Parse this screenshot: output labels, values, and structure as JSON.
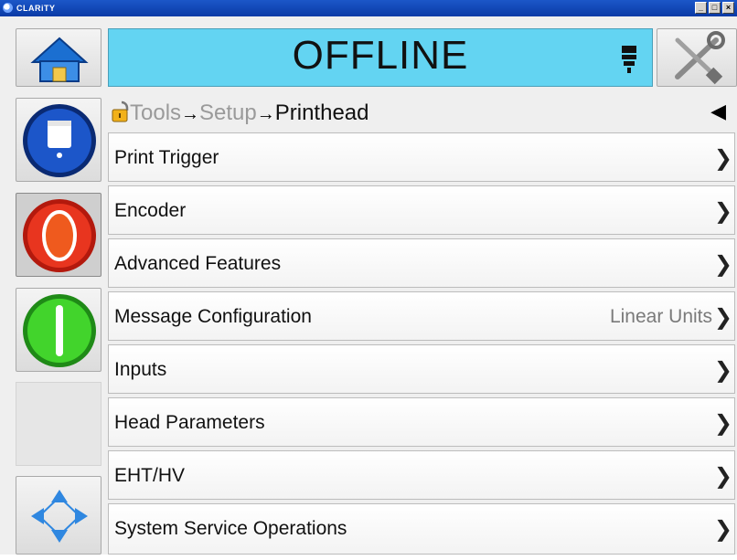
{
  "window": {
    "title": "CLARiTY",
    "min_glyph": "_",
    "max_glyph": "□",
    "close_glyph": "×"
  },
  "status": {
    "text": "OFFLINE",
    "bg_color": "#63d4f2"
  },
  "icons": {
    "home": "home-icon",
    "tools": "tools-icon",
    "ink": "ink-icon",
    "stop": "stop-icon",
    "start": "start-icon",
    "navigate": "navigation-arrows-icon",
    "printhead": "printhead-icon",
    "lock": "padlock-icon",
    "back": "back-arrow-icon"
  },
  "breadcrumb": {
    "items": [
      "Tools",
      "Setup",
      "Printhead"
    ],
    "separator": "→",
    "back_glyph": "◀"
  },
  "menu": {
    "chevron": "❯",
    "items": [
      {
        "label": "Print Trigger",
        "value": ""
      },
      {
        "label": "Encoder",
        "value": ""
      },
      {
        "label": "Advanced Features",
        "value": ""
      },
      {
        "label": "Message Configuration",
        "value": "Linear Units"
      },
      {
        "label": "Inputs",
        "value": ""
      },
      {
        "label": "Head Parameters",
        "value": ""
      },
      {
        "label": "EHT/HV",
        "value": ""
      },
      {
        "label": "System Service Operations",
        "value": ""
      }
    ]
  }
}
